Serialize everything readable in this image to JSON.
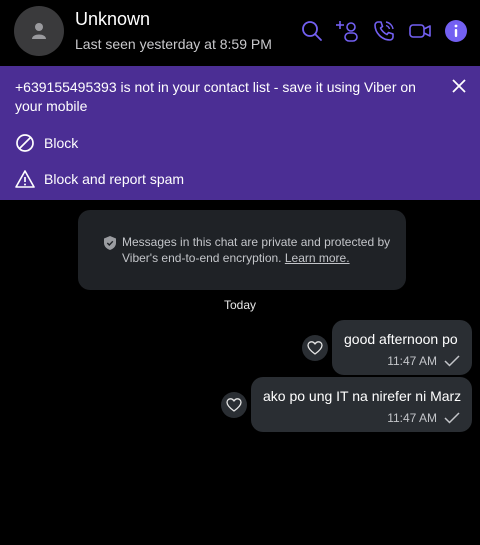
{
  "header": {
    "contact_name": "Unknown",
    "last_seen": "Last seen yesterday at 8:59 PM",
    "icons": [
      "search-icon",
      "add-participant-icon",
      "voice-call-icon",
      "video-call-icon",
      "info-icon"
    ]
  },
  "banner": {
    "message": "+639155495393 is not in your contact list - save it using Viber on your mobile",
    "block_label": "Block",
    "report_label": "Block and report spam",
    "background": "#4b2e94"
  },
  "encryption": {
    "text": "Messages in this chat are private and protected by Viber's end-to-end encryption.",
    "link": "Learn more."
  },
  "date_separator": "Today",
  "messages": [
    {
      "text": "good afternoon po",
      "time": "11:47 AM",
      "status": "delivered"
    },
    {
      "text": "ako po ung IT na nirefer ni Marz",
      "time": "11:47 AM",
      "status": "delivered"
    }
  ],
  "colors": {
    "accent": "#7360f2",
    "bubble": "#2a2e33",
    "background": "#000000"
  }
}
